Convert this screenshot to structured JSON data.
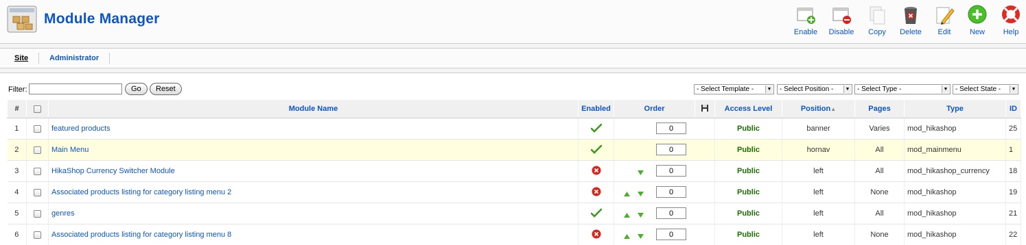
{
  "header": {
    "title": "Module Manager",
    "toolbar": [
      {
        "label": "Enable",
        "icon": "enable-icon"
      },
      {
        "label": "Disable",
        "icon": "disable-icon"
      },
      {
        "label": "Copy",
        "icon": "copy-icon"
      },
      {
        "label": "Delete",
        "icon": "delete-icon"
      },
      {
        "label": "Edit",
        "icon": "edit-icon"
      },
      {
        "label": "New",
        "icon": "new-icon"
      },
      {
        "label": "Help",
        "icon": "help-icon"
      }
    ]
  },
  "submenu": {
    "items": [
      {
        "label": "Site",
        "active": true
      },
      {
        "label": "Administrator",
        "active": false
      }
    ]
  },
  "filter": {
    "label": "Filter:",
    "value": "",
    "go_label": "Go",
    "reset_label": "Reset",
    "selects": [
      "- Select Template -",
      "- Select Position -",
      "- Select Type -",
      "- Select State -"
    ]
  },
  "table": {
    "headers": {
      "num": "#",
      "name": "Module Name",
      "enabled": "Enabled",
      "order": "Order",
      "access": "Access Level",
      "position": "Position",
      "pages": "Pages",
      "type": "Type",
      "id": "ID"
    },
    "rows": [
      {
        "num": "1",
        "name": "featured products",
        "enabled": true,
        "up": false,
        "down": false,
        "order": "0",
        "access": "Public",
        "position": "banner",
        "pages": "Varies",
        "type": "mod_hikashop",
        "id": "25"
      },
      {
        "num": "2",
        "name": "Main Menu",
        "enabled": true,
        "up": false,
        "down": false,
        "order": "0",
        "access": "Public",
        "position": "hornav",
        "pages": "All",
        "type": "mod_mainmenu",
        "id": "1"
      },
      {
        "num": "3",
        "name": "HikaShop Currency Switcher Module",
        "enabled": false,
        "up": false,
        "down": true,
        "order": "0",
        "access": "Public",
        "position": "left",
        "pages": "All",
        "type": "mod_hikashop_currency",
        "id": "18"
      },
      {
        "num": "4",
        "name": "Associated products listing for category listing menu 2",
        "enabled": false,
        "up": true,
        "down": true,
        "order": "0",
        "access": "Public",
        "position": "left",
        "pages": "None",
        "type": "mod_hikashop",
        "id": "19"
      },
      {
        "num": "5",
        "name": "genres",
        "enabled": true,
        "up": true,
        "down": true,
        "order": "0",
        "access": "Public",
        "position": "left",
        "pages": "All",
        "type": "mod_hikashop",
        "id": "21"
      },
      {
        "num": "6",
        "name": "Associated products listing for category listing menu 8",
        "enabled": false,
        "up": true,
        "down": true,
        "order": "0",
        "access": "Public",
        "position": "left",
        "pages": "None",
        "type": "mod_hikashop",
        "id": "22"
      }
    ]
  },
  "colors": {
    "link": "#0b55c4",
    "public": "#1a6e00",
    "highlight_row": "#ffffe0"
  }
}
